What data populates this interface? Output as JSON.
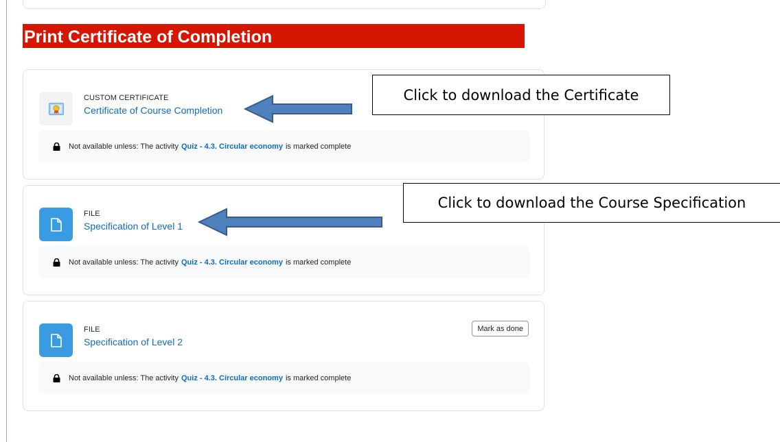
{
  "section": {
    "title": "Print Certificate of Completion"
  },
  "activities": [
    {
      "type_label": "CUSTOM CERTIFICATE",
      "name": "Certificate of Course Completion",
      "icon": "certificate-icon",
      "restriction": {
        "prefix": "Not available unless: The activity",
        "link": "Quiz - 4.3. Circular economy",
        "suffix": "is marked complete"
      }
    },
    {
      "type_label": "FILE",
      "name": "Specification of Level 1",
      "icon": "file-icon",
      "restriction": {
        "prefix": "Not available unless: The activity",
        "link": "Quiz - 4.3. Circular economy",
        "suffix": "is marked complete"
      }
    },
    {
      "type_label": "FILE",
      "name": "Specification of Level 2",
      "icon": "file-icon",
      "mark_done": "Mark as done",
      "restriction": {
        "prefix": "Not available unless: The activity",
        "link": "Quiz - 4.3. Circular economy",
        "suffix": "is marked complete"
      }
    }
  ],
  "callouts": [
    {
      "text": "Click to download the Certificate"
    },
    {
      "text": "Click to download the Course Specification"
    }
  ],
  "colors": {
    "header_bg": "#d41603",
    "link": "#0f6cbf",
    "file_icon_bg": "#399be2",
    "arrow_fill": "#4f81bd",
    "arrow_stroke": "#385d8a"
  }
}
